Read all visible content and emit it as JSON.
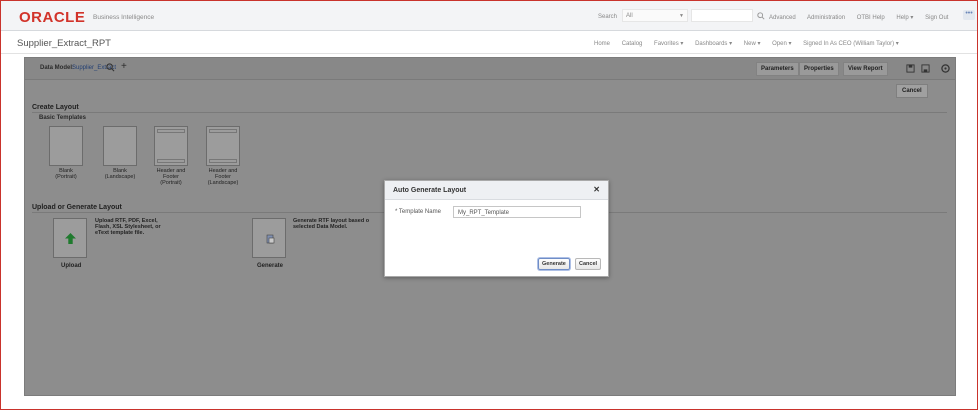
{
  "app": {
    "logo": "ORACLE",
    "product": "Business Intelligence",
    "brand_color": "#d2332a"
  },
  "topbar": {
    "search_label": "Search",
    "search_scope": "All",
    "links": [
      "Advanced",
      "Administration",
      "OTBI Help",
      "Help ▾",
      "Sign Out"
    ]
  },
  "secondbar": {
    "page_title": "Supplier_Extract_RPT",
    "links": [
      "Home",
      "Catalog",
      "Favorites ▾",
      "Dashboards ▾",
      "New ▾",
      "Open ▾",
      "Signed In As  CEO (William Taylor) ▾"
    ]
  },
  "workspace": {
    "data_model_label": "Data Model:",
    "data_model_value": "Supplier_Extract",
    "buttons": {
      "parameters": "Parameters",
      "properties": "Properties",
      "view_report": "View Report",
      "cancel": "Cancel"
    },
    "create_layout_title": "Create Layout",
    "basic_templates_title": "Basic Templates",
    "templates": [
      {
        "caption": "Blank\n(Portrait)"
      },
      {
        "caption": "Blank\n(Landscape)"
      },
      {
        "caption": "Header and\nFooter\n(Portrait)"
      },
      {
        "caption": "Header and\nFooter\n(Landscape)"
      }
    ],
    "upload_generate_title": "Upload or Generate Layout",
    "upload_desc": "Upload RTF, PDF, Excel,\nFlash, XSL Stylesheet, or\neText template file.",
    "upload_label": "Upload",
    "generate_desc": "Generate RTF layout based o\nselected Data Model.",
    "generate_label": "Generate"
  },
  "dialog": {
    "title": "Auto Generate Layout",
    "field_label": "* Template Name",
    "field_value": "My_RPT_Template",
    "generate_button": "Generate",
    "cancel_button": "Cancel"
  }
}
